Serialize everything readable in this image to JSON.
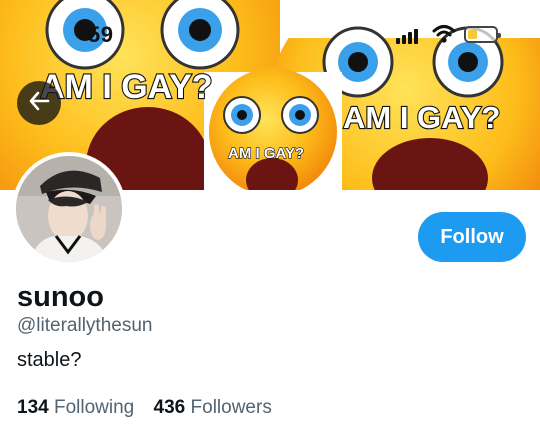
{
  "status_bar": {
    "time": "59"
  },
  "banner": {
    "text_left": "AM I GAY?",
    "text_center": "AM I GAY?",
    "text_right": "AM I GAY?"
  },
  "profile": {
    "follow_label": "Follow",
    "display_name": "sunoo",
    "handle": "@literallythesun",
    "bio": "stable?",
    "following_count": "134",
    "following_label": "Following",
    "followers_count": "436",
    "followers_label": "Followers"
  },
  "colors": {
    "accent": "#1d9bf0",
    "text_primary": "#0f1419",
    "text_secondary": "#536471"
  },
  "icons": [
    "back-arrow-icon",
    "signal-icon",
    "wifi-icon",
    "battery-icon"
  ]
}
